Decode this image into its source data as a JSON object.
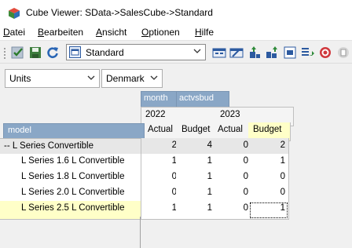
{
  "window": {
    "title": "Cube Viewer: SData->SalesCube->Standard"
  },
  "menu": [
    {
      "label": "Datei",
      "accel": "D",
      "rest": "atei"
    },
    {
      "label": "Bearbeiten",
      "accel": "B",
      "rest": "earbeiten"
    },
    {
      "label": "Ansicht",
      "accel": "A",
      "rest": "nsicht"
    },
    {
      "label": "Optionen",
      "accel": "O",
      "rest": "ptionen"
    },
    {
      "label": "Hilfe",
      "accel": "H",
      "rest": "ilfe"
    }
  ],
  "toolbar": {
    "view_name": "Standard",
    "icons": [
      "recalculate-checkmark-icon",
      "save-icon",
      "refresh-icon",
      "view-selector-icon"
    ],
    "right_icons": [
      "cube-icon",
      "dimension-edit-icon",
      "suppress-zeros-icon",
      "suppress-zeros-rows-icon",
      "format-icon",
      "export-icon",
      "stop-icon",
      "new-view-icon"
    ]
  },
  "title_dims": [
    {
      "name": "units-select",
      "value": "Units"
    },
    {
      "name": "country-select",
      "value": "Denmark"
    }
  ],
  "grid": {
    "column_dims": [
      "month",
      "actvsbud"
    ],
    "row_dim": "model",
    "years": [
      "2022",
      "2023"
    ],
    "versions": [
      "Actual",
      "Budget",
      "Actual",
      "Budget"
    ],
    "rows": [
      {
        "label": "-- L Series Convertible",
        "values": [
          "2",
          "4",
          "0",
          "2"
        ],
        "consolidated": true
      },
      {
        "label": "L Series 1.6 L Convertible",
        "values": [
          "1",
          "1",
          "0",
          "1"
        ],
        "consolidated": false
      },
      {
        "label": "L Series 1.8 L Convertible",
        "values": [
          "0",
          "1",
          "0",
          "0"
        ],
        "consolidated": false
      },
      {
        "label": "L Series 2.0 L Convertible",
        "values": [
          "0",
          "1",
          "0",
          "0"
        ],
        "consolidated": false
      },
      {
        "label": "L Series 2.5 L Convertible",
        "values": [
          "1",
          "1",
          "0",
          "1"
        ],
        "consolidated": false,
        "selected": true
      }
    ]
  },
  "colors": {
    "dim_header": "#8aa7c6",
    "selected_header": "#ffffc8",
    "consolidated": "#e7e7e7"
  }
}
